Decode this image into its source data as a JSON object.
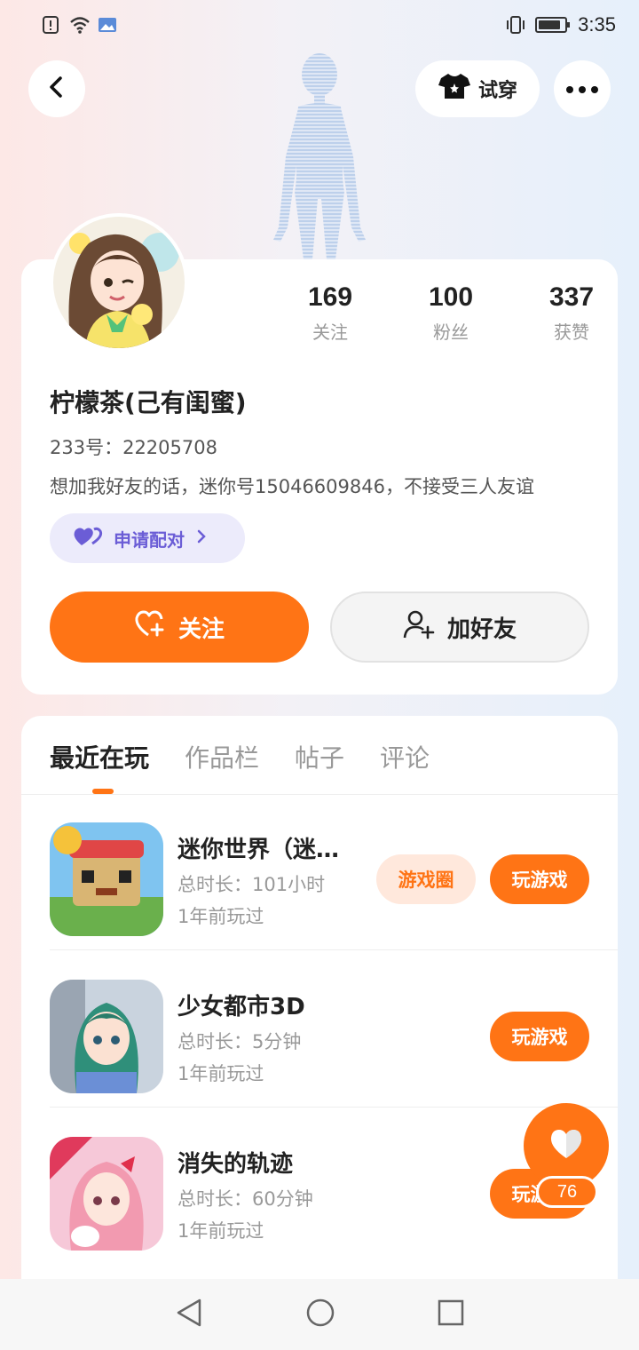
{
  "status_bar": {
    "time": "3:35",
    "battery_level": 0.75
  },
  "header": {
    "tryon_label": "试穿"
  },
  "profile": {
    "stats": [
      {
        "value": "169",
        "label": "关注"
      },
      {
        "value": "100",
        "label": "粉丝"
      },
      {
        "value": "337",
        "label": "获赞"
      }
    ],
    "nickname": "柠檬茶(己有闺蜜)",
    "uid": "233号：22205708",
    "bio": "想加我好友的话，迷你号15046609846，不接受三人友谊",
    "pair_label": "申请配对",
    "follow_label": "关注",
    "add_friend_label": "加好友"
  },
  "tabs": [
    {
      "label": "最近在玩",
      "active": true
    },
    {
      "label": "作品栏",
      "active": false
    },
    {
      "label": "帖子",
      "active": false
    },
    {
      "label": "评论",
      "active": false
    }
  ],
  "games": [
    {
      "name": "迷你世界（迷…",
      "duration": "总时长：101小时",
      "last_played": "1年前玩过",
      "circle_label": "游戏圈",
      "play_label": "玩游戏"
    },
    {
      "name": "少女都市3D",
      "duration": "总时长：5分钟",
      "last_played": "1年前玩过",
      "play_label": "玩游戏"
    },
    {
      "name": "消失的轨迹",
      "duration": "总时长：60分钟",
      "last_played": "1年前玩过",
      "play_label": "玩游戏"
    }
  ],
  "like": {
    "count": "76"
  },
  "colors": {
    "accent": "#ff7415",
    "pair": "#6b5dd6"
  }
}
